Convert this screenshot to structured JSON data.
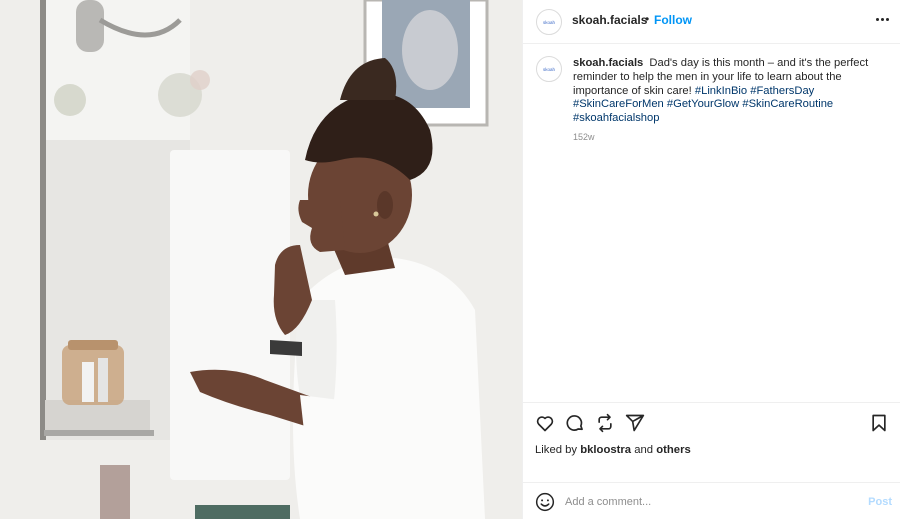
{
  "account": {
    "username": "skoah.facials",
    "avatar_text": "skoah",
    "follow_label": "Follow",
    "separator": "•"
  },
  "caption": {
    "username": "skoah.facials",
    "text": "Dad's day is this month – and it's the perfect reminder to help the men in your life to learn about the importance of skin care!",
    "hashtags": [
      "#LinkInBio",
      "#FathersDay",
      "#SkinCareForMen",
      "#GetYourGlow",
      "#SkinCareRoutine",
      "#skoahfacialshop"
    ],
    "time": "152w"
  },
  "likes": {
    "prefix": "Liked by",
    "user": "bkloostra",
    "joiner": "and",
    "others": "others"
  },
  "comment": {
    "placeholder": "Add a comment...",
    "post_label": "Post"
  },
  "icons": {
    "more": "more-options-icon",
    "like": "heart-icon",
    "comment": "comment-icon",
    "share": "repost-icon",
    "send": "send-icon",
    "save": "bookmark-icon",
    "emoji": "emoji-icon"
  },
  "colors": {
    "follow": "#0095f6",
    "hashtag": "#00376b",
    "post_disabled": "#b3dbff",
    "muted": "#8e8e8e"
  }
}
